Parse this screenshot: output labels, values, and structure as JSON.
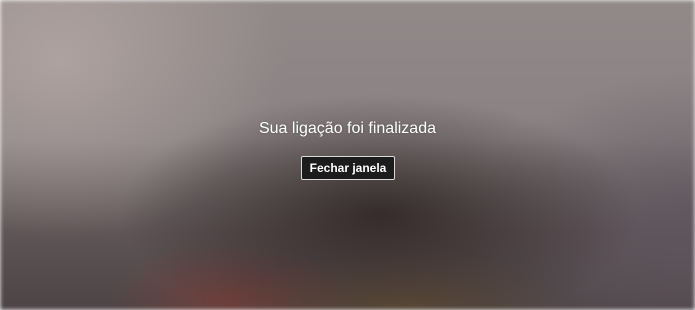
{
  "call_end": {
    "message": "Sua ligação foi finalizada",
    "close_button_label": "Fechar janela"
  }
}
